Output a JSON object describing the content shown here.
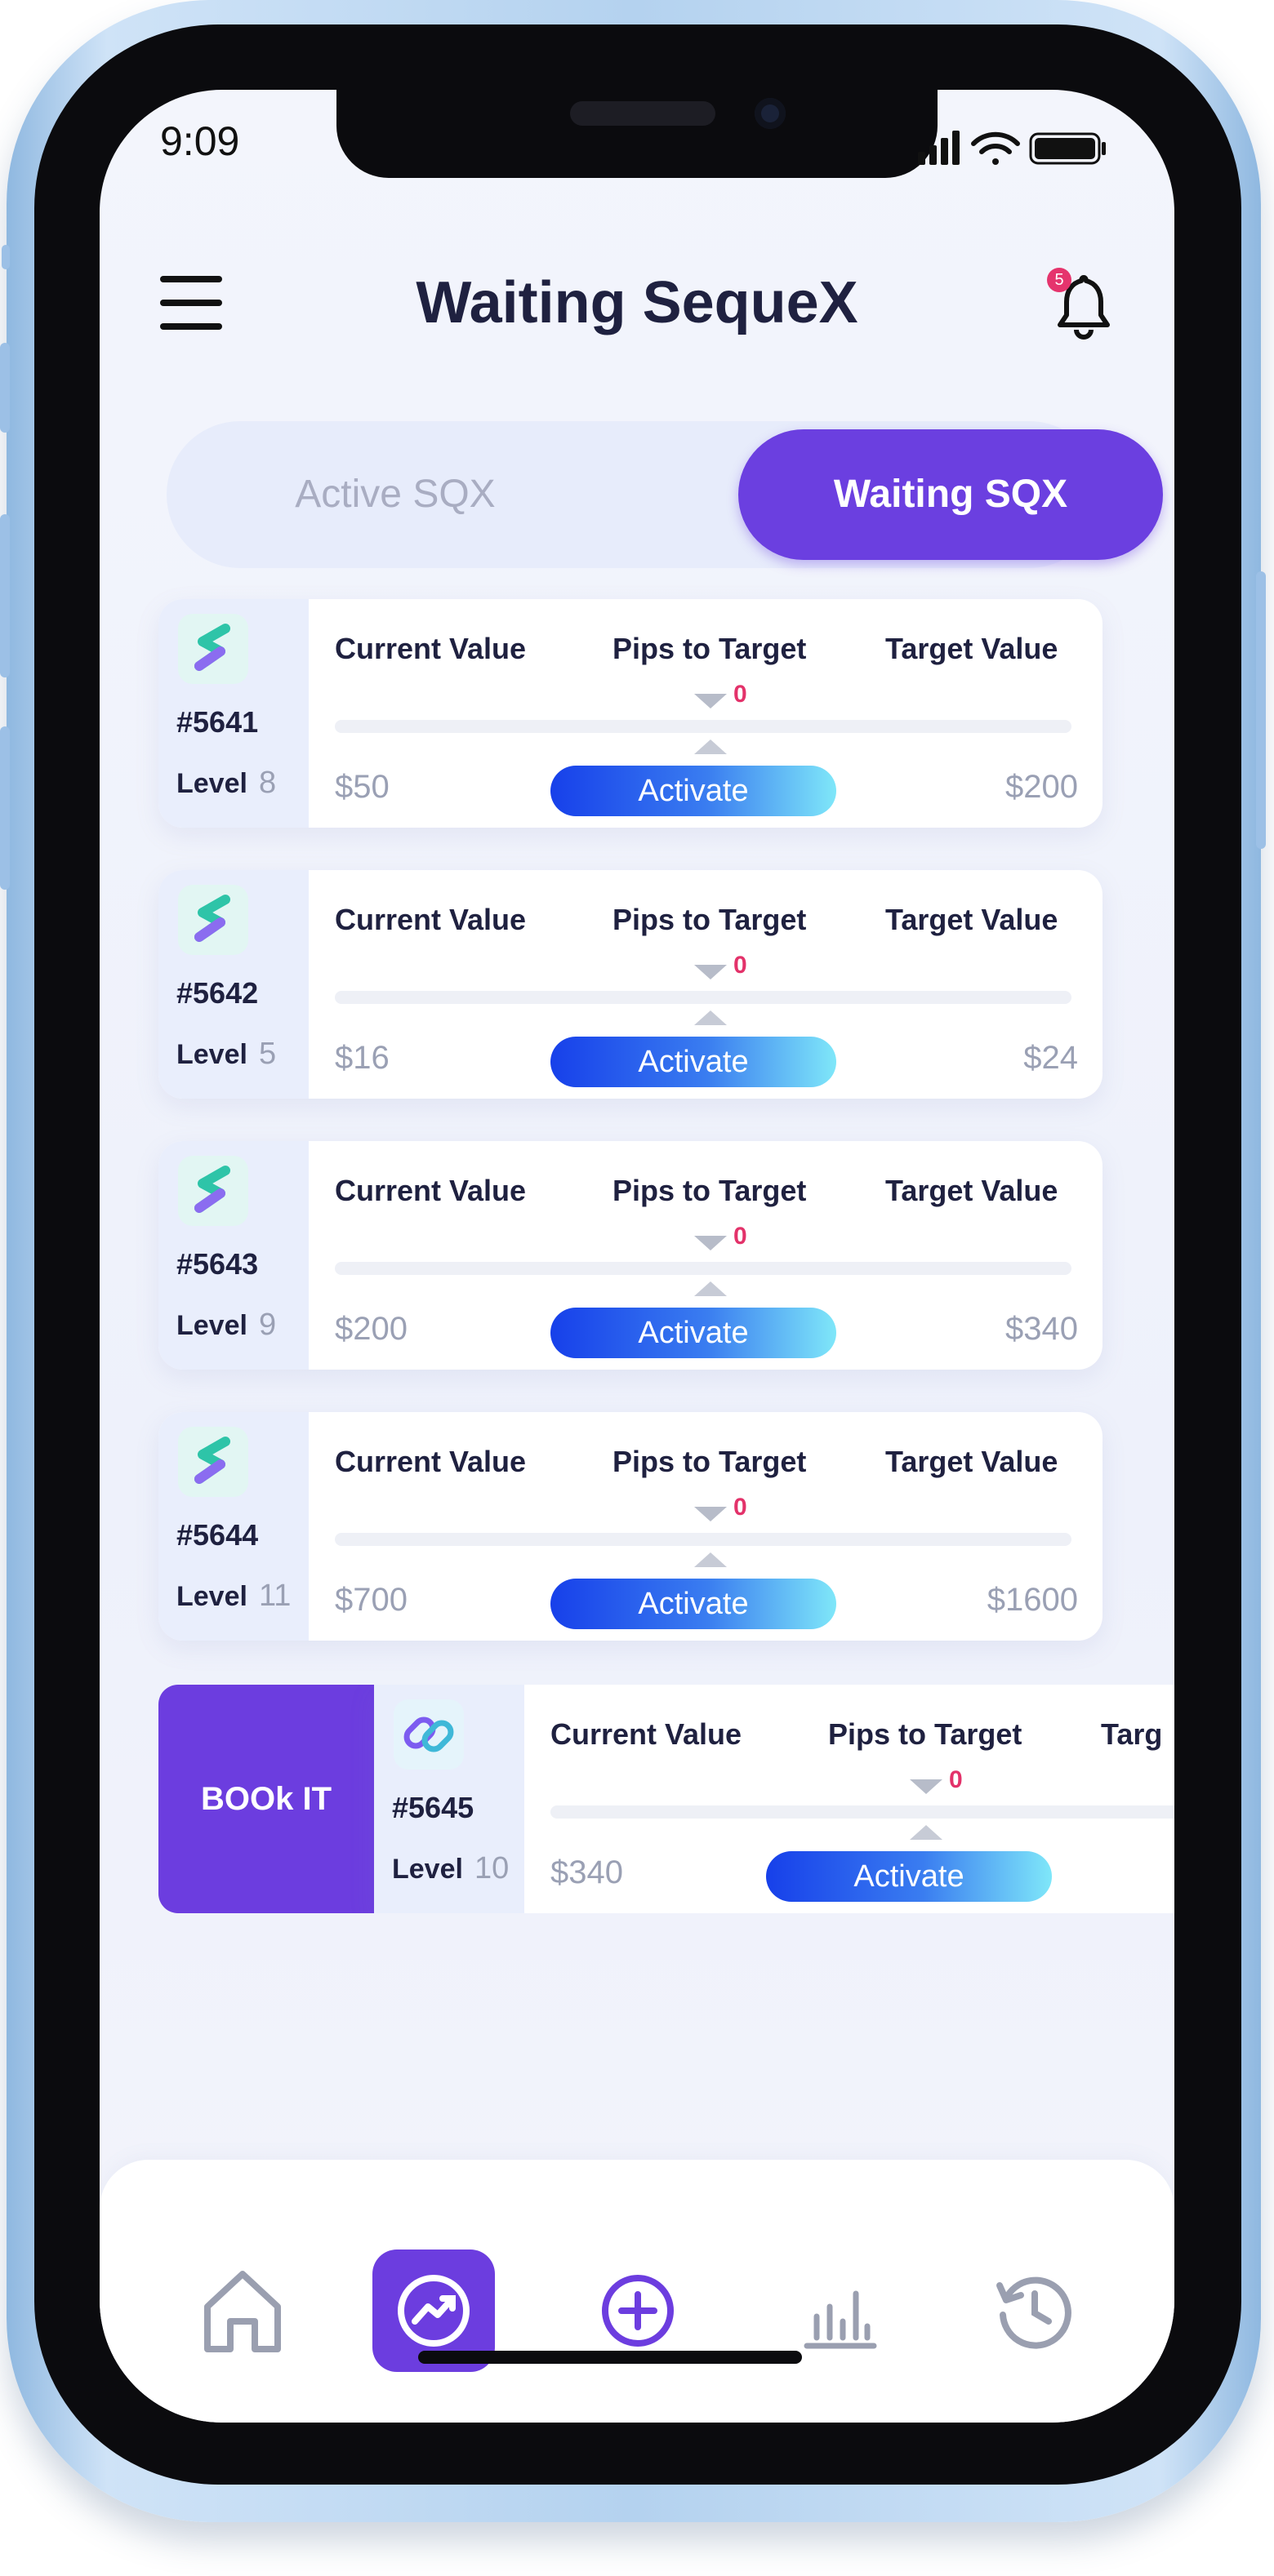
{
  "status_bar": {
    "time": "9:09"
  },
  "header": {
    "title": "Waiting SequeX",
    "notification_count": "5"
  },
  "tabs": [
    {
      "label": "Active SQX",
      "active": false
    },
    {
      "label": "Waiting SQX",
      "active": true
    }
  ],
  "column_headers": {
    "current": "Current Value",
    "pips": "Pips to Target",
    "target": "Target Value"
  },
  "level_label": "Level",
  "activate_label": "Activate",
  "book_label": "BOOk IT",
  "cards": [
    {
      "id": "#5641",
      "level": "8",
      "current_value": "$50",
      "pips": "0",
      "target_value": "$200"
    },
    {
      "id": "#5642",
      "level": "5",
      "current_value": "$16",
      "pips": "0",
      "target_value": "$24"
    },
    {
      "id": "#5643",
      "level": "9",
      "current_value": "$200",
      "pips": "0",
      "target_value": "$340"
    },
    {
      "id": "#5644",
      "level": "11",
      "current_value": "$700",
      "pips": "0",
      "target_value": "$1600"
    },
    {
      "id": "#5645",
      "level": "10",
      "current_value": "$340",
      "pips": "0",
      "target_value": "",
      "target_header_visible": "Targ"
    }
  ],
  "bottom_nav": [
    {
      "icon": "home-icon",
      "active": false
    },
    {
      "icon": "trending-icon",
      "active": true
    },
    {
      "icon": "add-circle-icon",
      "active": false
    },
    {
      "icon": "bar-chart-icon",
      "active": false
    },
    {
      "icon": "history-icon",
      "active": false
    }
  ],
  "colors": {
    "accent": "#6c3ddf",
    "badge": "#e5346d",
    "pips": "#e3326a",
    "activate_start": "#1740ea",
    "activate_end": "#7fe7f9"
  }
}
